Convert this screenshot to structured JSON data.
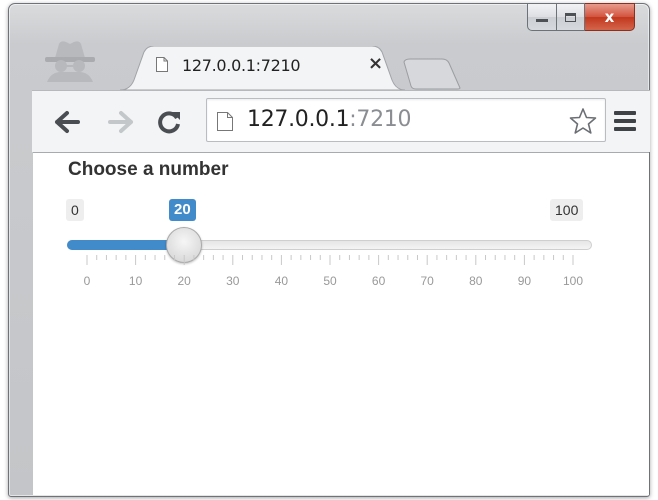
{
  "browser": {
    "tab": {
      "title": "127.0.0.1:7210",
      "close_glyph": "×"
    },
    "address": {
      "host": "127.0.0.1",
      "port": ":7210"
    },
    "icons": [
      "incognito-icon",
      "page-icon",
      "back-arrow-icon",
      "forward-arrow-icon",
      "reload-icon",
      "star-icon",
      "menu-icon"
    ]
  },
  "window": {
    "controls": {
      "close_glyph": "x"
    }
  },
  "slider": {
    "label": "Choose a number",
    "min": 0,
    "max": 100,
    "value": 20,
    "min_label": "0",
    "max_label": "100",
    "value_label": "20",
    "tick_labels": [
      "0",
      "10",
      "20",
      "30",
      "40",
      "50",
      "60",
      "70",
      "80",
      "90",
      "100"
    ],
    "accent_color": "#428bca"
  }
}
